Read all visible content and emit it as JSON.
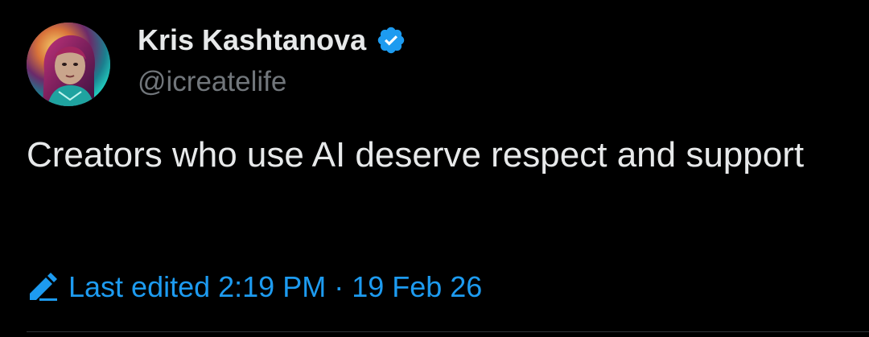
{
  "author": {
    "display_name": "Kris Kashtanova",
    "handle": "@icreatelife",
    "verified": true,
    "verified_icon": "verified-badge-icon"
  },
  "tweet": {
    "text": "Creators who use AI deserve respect and support"
  },
  "edit_info": {
    "icon": "pencil-icon",
    "label": "Last edited 2:19 PM · 19 Feb 26"
  },
  "colors": {
    "background": "#000000",
    "text_primary": "#e7e9ea",
    "text_secondary": "#71767b",
    "accent": "#1d9bf0",
    "divider": "#2f3336"
  }
}
